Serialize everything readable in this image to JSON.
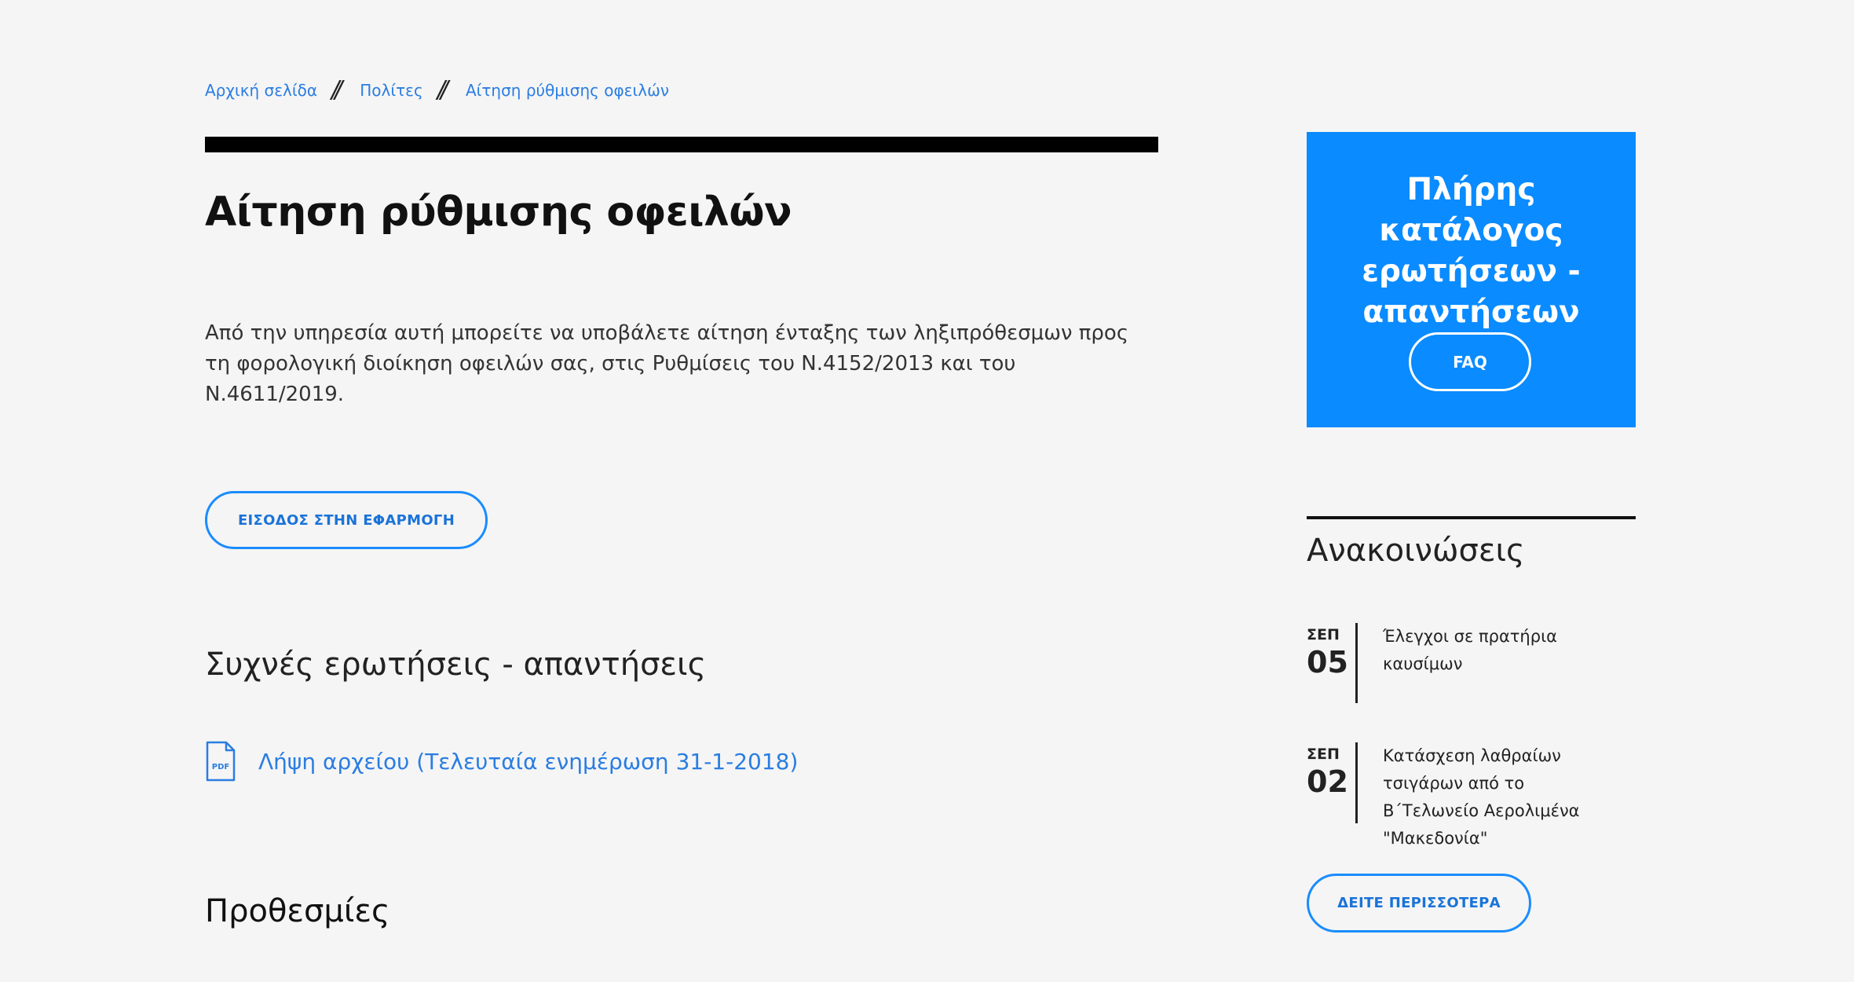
{
  "breadcrumb": {
    "items": [
      "Αρχική σελίδα",
      "Πολίτες",
      "Αίτηση ρύθμισης οφειλών"
    ],
    "separator": "//"
  },
  "page": {
    "title": "Αίτηση ρύθμισης οφειλών",
    "intro": "Από την υπηρεσία αυτή μπορείτε να υποβάλετε αίτηση ένταξης των ληξιπρόθεσμων προς τη φορολογική διοίκηση οφειλών σας, στις Ρυθμίσεις του Ν.4152/2013 και του Ν.4611/2019.",
    "app_button": "ΕΙΣΟΔΟΣ ΣΤΗΝ ΕΦΑΡΜΟΓΗ",
    "faq_heading": "Συχνές ερωτήσεις - απαντήσεις",
    "file_link": "Λήψη αρχείου (Τελευταία ενημέρωση 31-1-2018)",
    "file_icon": "pdf-icon",
    "file_icon_label": "PDF",
    "deadlines_heading": "Προθεσμίες"
  },
  "faq_box": {
    "title": "Πλήρης κατάλογος ερωτήσεων - απαντήσεων",
    "button": "FAQ",
    "background": "#0a8bff"
  },
  "announcements": {
    "heading": "Ανακοινώσεις",
    "items": [
      {
        "month": "ΣΕΠ",
        "day": "05",
        "text": "Έλεγχοι σε πρατήρια καυσίμων"
      },
      {
        "month": "ΣΕΠ",
        "day": "02",
        "text": "Κατάσχεση λαθραίων τσιγάρων από το Β΄Τελωνείο Αερολιμένα \"Μακεδονία\""
      }
    ],
    "more_button": "ΔΕΙΤΕ ΠΕΡΙΣΣΟΤΕΡΑ"
  },
  "colors": {
    "accent": "#1a8cff",
    "link": "#2a7de1",
    "background": "#f5f5f5"
  }
}
